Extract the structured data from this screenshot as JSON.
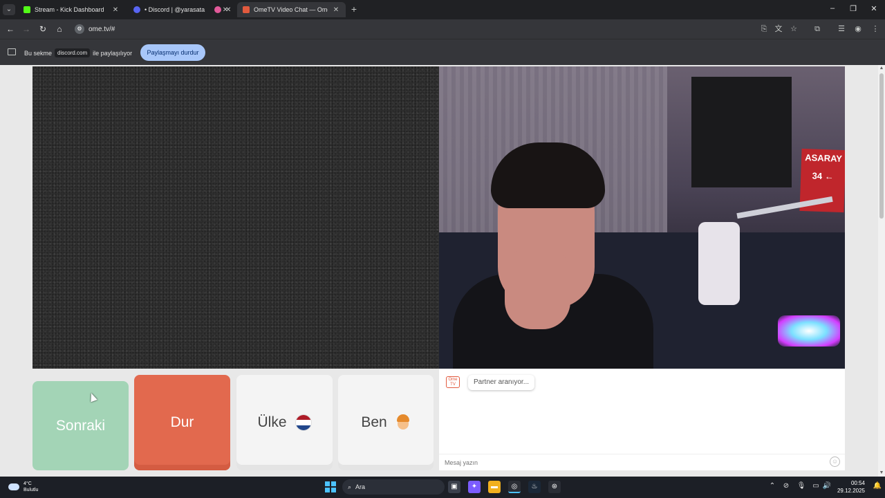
{
  "browser": {
    "tabs": [
      {
        "title": "Stream - Kick Dashboard",
        "favicon_color": "#53fc18"
      },
      {
        "title": "• Discord | @yarasata",
        "favicon_color": "#5865f2"
      },
      {
        "title": "",
        "favicon_color": "#e25a9a"
      },
      {
        "title": "OmeTV Video Chat — Ome",
        "favicon_color": "#e25a3e"
      }
    ],
    "url": "ome.tv/#",
    "sharing": {
      "prefix": "Bu sekme",
      "site": "discord.com",
      "suffix": "ile paylaşılıyor",
      "stop_label": "Paylaşmayı durdur"
    }
  },
  "controls": {
    "next_label": "Sonraki",
    "stop_label": "Dur",
    "country_label": "Ülke",
    "me_label": "Ben"
  },
  "flag_colors": [
    "#ae1c28",
    "#ffffff",
    "#21468b"
  ],
  "chat": {
    "status": "Partner aranıyor...",
    "input_placeholder": "Mesaj yazın",
    "logo_text": "Ome TV"
  },
  "video_right": {
    "sign_text": "ASARAY 34 ←"
  },
  "taskbar": {
    "weather_temp": "4°C",
    "weather_desc": "Bulutlu",
    "search_label": "Ara",
    "time": "00:54",
    "date": "29.12.2025"
  },
  "colors": {
    "stop_button": "#e2694e",
    "next_button": "#a3d4b6",
    "share_button": "#a8c7fa"
  }
}
